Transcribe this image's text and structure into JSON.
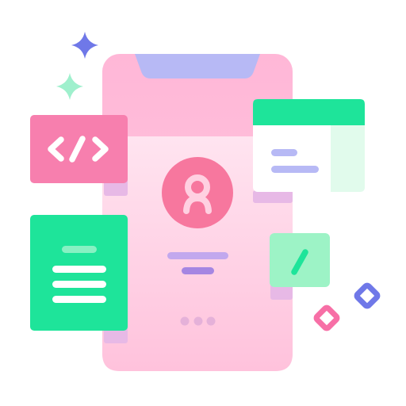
{
  "illustration": {
    "subject": "mobile-app-development",
    "colors": {
      "phone_top": "#ffb5d6",
      "phone_bottom": "#ffc4dd",
      "phone_screen": "#ffe0ee",
      "notch": "#b7b9f5",
      "avatar_circle": "#f7779e",
      "avatar_figure": "#ffd0e1",
      "code_card": "#f77fae",
      "code_card_shadow": "#e7a6d6",
      "doc_card": "#1ee49a",
      "doc_line_accent": "#87f1c3",
      "window_header": "#1ee49a",
      "window_side": "#e1fbec",
      "window_body": "#ffffff",
      "window_line": "#b7b9f5",
      "pencil_card": "#9df3c6",
      "pencil_mark": "#1ee49a",
      "line_purple_light": "#c2a8ee",
      "line_purple_dark": "#a586e2",
      "dots": "#e5b1d9",
      "sparkle_blue": "#6f78e8",
      "sparkle_mint": "#9ff0cd",
      "diamond_pink": "#f76fa6",
      "diamond_blue": "#6f78e8"
    },
    "icons": [
      "code-brackets-icon",
      "document-icon",
      "window-icon",
      "pencil-icon",
      "user-avatar-icon",
      "sparkle-icon",
      "diamond-icon"
    ]
  }
}
